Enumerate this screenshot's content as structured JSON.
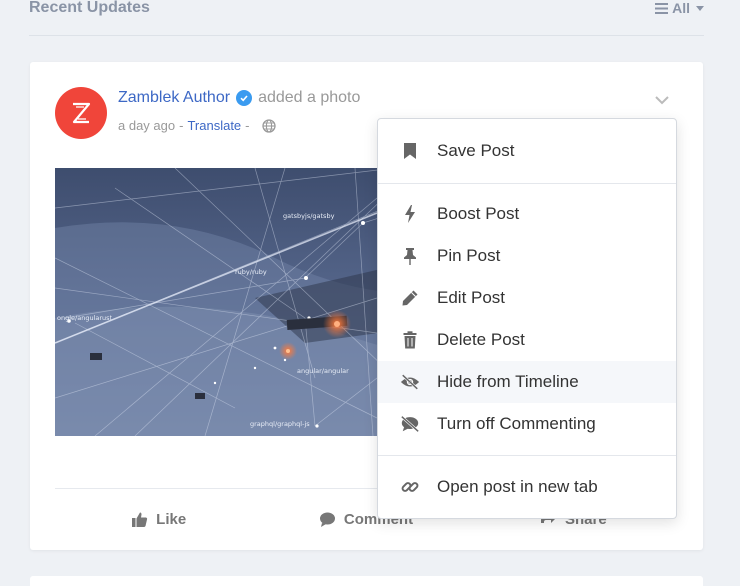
{
  "section": {
    "title": "Recent Updates",
    "filter_label": "All"
  },
  "post": {
    "author_name": "Zamblek Author",
    "action_text": "added a photo",
    "time": "a day ago",
    "separator": "-",
    "translate": "Translate",
    "separator2": "-",
    "photo_labels": [
      "gatsbyjs/gatsby",
      "ruby/ruby",
      "ongle/angularust",
      "angular/angular",
      "graphql/graphql-js"
    ]
  },
  "actions": {
    "like": "Like",
    "comment": "Comment",
    "share": "Share"
  },
  "menu": {
    "items": [
      {
        "label": "Save Post",
        "icon": "bookmark-icon"
      },
      {
        "label": "Boost Post",
        "icon": "bolt-icon"
      },
      {
        "label": "Pin Post",
        "icon": "pin-icon"
      },
      {
        "label": "Edit Post",
        "icon": "pencil-icon"
      },
      {
        "label": "Delete Post",
        "icon": "trash-icon"
      },
      {
        "label": "Hide from Timeline",
        "icon": "eye-slash-icon"
      },
      {
        "label": "Turn off Commenting",
        "icon": "comment-slash-icon"
      },
      {
        "label": "Open post in new tab",
        "icon": "link-icon"
      }
    ]
  },
  "colors": {
    "brand": "#f0453a",
    "link": "#3d68c5",
    "verified": "#3a9bf0",
    "muted": "#8a94a6"
  }
}
